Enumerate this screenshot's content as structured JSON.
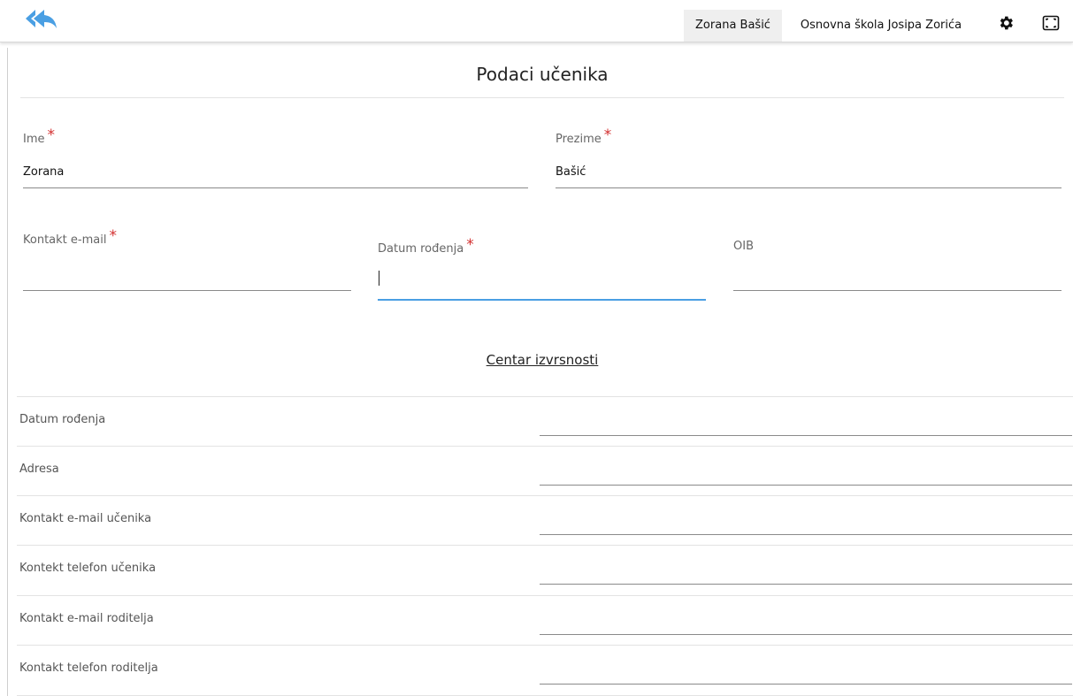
{
  "header": {
    "user_name": "Zorana Bašić",
    "school_name": "Osnovna škola Josipa Zorića",
    "icons": {
      "back": "double-reply-icon",
      "settings": "gear-icon",
      "fullscreen": "fullscreen-icon"
    },
    "accent_color": "#4a9fe3"
  },
  "form": {
    "title": "Podaci učenika",
    "required_marker": "*",
    "fields": {
      "ime": {
        "label": "Ime",
        "value": "Zorana",
        "required": true
      },
      "prezime": {
        "label": "Prezime",
        "value": "Bašić",
        "required": true
      },
      "email": {
        "label": "Kontakt e-mail",
        "value": "",
        "required": true
      },
      "datum": {
        "label": "Datum rođenja",
        "value": "",
        "required": true,
        "focused": true
      },
      "oib": {
        "label": "OIB",
        "value": "",
        "required": false
      }
    }
  },
  "section": {
    "title": "Centar izvrsnosti",
    "rows": [
      {
        "label": "Datum rođenja"
      },
      {
        "label": "Adresa"
      },
      {
        "label": "Kontakt e-mail učenika"
      },
      {
        "label": "Kontekt telefon učenika"
      },
      {
        "label": "Kontakt e-mail roditelja"
      },
      {
        "label": "Kontakt telefon roditelja"
      }
    ]
  }
}
